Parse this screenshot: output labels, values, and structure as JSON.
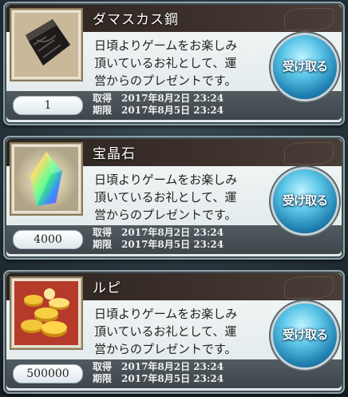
{
  "gifts": [
    {
      "name": "ダマスカス鋼",
      "message_lines": [
        "日頃よりゲームをお楽しみ",
        "頂いているお礼として、運",
        "営からのプレゼントです。"
      ],
      "quantity": "1",
      "acquired_label": "取得",
      "acquired_date": "2017年8月2日 23:24",
      "expiry_label": "期限",
      "expiry_date": "2017年8月5日 23:24",
      "button_label": "受け取る",
      "icon": "damascus-steel-icon"
    },
    {
      "name": "宝晶石",
      "message_lines": [
        "日頃よりゲームをお楽しみ",
        "頂いているお礼として、運",
        "営からのプレゼントです。"
      ],
      "quantity": "4000",
      "acquired_label": "取得",
      "acquired_date": "2017年8月2日 23:24",
      "expiry_label": "期限",
      "expiry_date": "2017年8月5日 23:24",
      "button_label": "受け取る",
      "icon": "crystal-icon"
    },
    {
      "name": "ルピ",
      "message_lines": [
        "日頃よりゲームをお楽しみ",
        "頂いているお礼として、運",
        "営からのプレゼントです。"
      ],
      "quantity": "500000",
      "acquired_label": "取得",
      "acquired_date": "2017年8月2日 23:24",
      "expiry_label": "期限",
      "expiry_date": "2017年8月5日 23:24",
      "button_label": "受け取る",
      "icon": "rupie-coins-icon"
    }
  ]
}
